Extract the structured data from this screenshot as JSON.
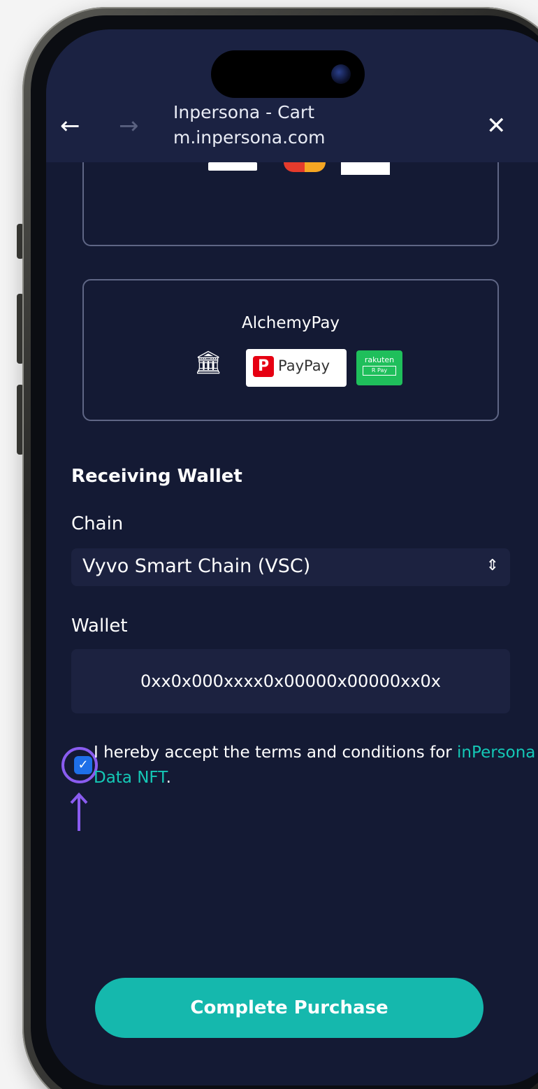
{
  "browser": {
    "title": "Inpersona - Cart",
    "url": "m.inpersona.com",
    "back_icon": "arrow-left-icon",
    "forward_icon": "arrow-right-icon",
    "close_icon": "close-icon"
  },
  "payment_options": {
    "alchemy": {
      "title": "AlchemyPay",
      "paypay_label": "PayPay",
      "paypay_mark": "P",
      "rakuten_label": "rakuten",
      "rakuten_sub": "R Pay"
    }
  },
  "wallet_section": {
    "title": "Receiving Wallet",
    "chain_label": "Chain",
    "chain_value": "Vyvo Smart Chain (VSC)",
    "wallet_label": "Wallet",
    "wallet_value": "0xx0x000xxxx0x00000x00000xx0x"
  },
  "terms": {
    "text": "I hereby accept the terms and conditions for ",
    "link_text": "inPersona Data NFT",
    "trailing": ".",
    "checked": true
  },
  "actions": {
    "complete_purchase": "Complete Purchase"
  },
  "colors": {
    "screen_bg": "#141a34",
    "accent": "#15b8ad",
    "link": "#14c8b6",
    "highlight": "#8a5cf0"
  }
}
